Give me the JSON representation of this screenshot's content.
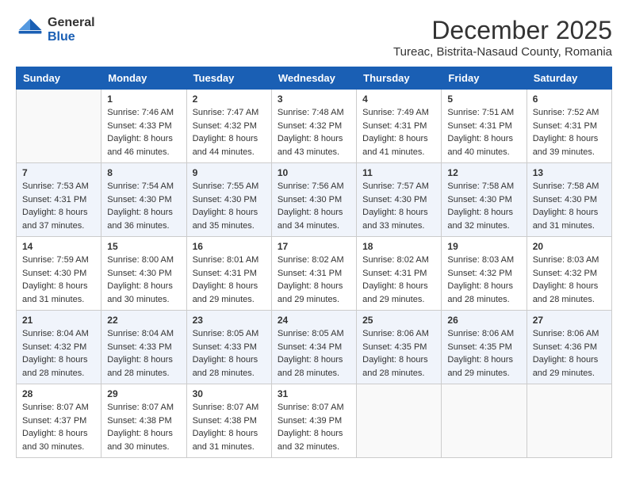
{
  "header": {
    "logo_line1": "General",
    "logo_line2": "Blue",
    "title": "December 2025",
    "subtitle": "Tureac, Bistrita-Nasaud County, Romania"
  },
  "weekdays": [
    "Sunday",
    "Monday",
    "Tuesday",
    "Wednesday",
    "Thursday",
    "Friday",
    "Saturday"
  ],
  "weeks": [
    [
      {
        "day": "",
        "sunrise": "",
        "sunset": "",
        "daylight": ""
      },
      {
        "day": "1",
        "sunrise": "Sunrise: 7:46 AM",
        "sunset": "Sunset: 4:33 PM",
        "daylight": "Daylight: 8 hours and 46 minutes."
      },
      {
        "day": "2",
        "sunrise": "Sunrise: 7:47 AM",
        "sunset": "Sunset: 4:32 PM",
        "daylight": "Daylight: 8 hours and 44 minutes."
      },
      {
        "day": "3",
        "sunrise": "Sunrise: 7:48 AM",
        "sunset": "Sunset: 4:32 PM",
        "daylight": "Daylight: 8 hours and 43 minutes."
      },
      {
        "day": "4",
        "sunrise": "Sunrise: 7:49 AM",
        "sunset": "Sunset: 4:31 PM",
        "daylight": "Daylight: 8 hours and 41 minutes."
      },
      {
        "day": "5",
        "sunrise": "Sunrise: 7:51 AM",
        "sunset": "Sunset: 4:31 PM",
        "daylight": "Daylight: 8 hours and 40 minutes."
      },
      {
        "day": "6",
        "sunrise": "Sunrise: 7:52 AM",
        "sunset": "Sunset: 4:31 PM",
        "daylight": "Daylight: 8 hours and 39 minutes."
      }
    ],
    [
      {
        "day": "7",
        "sunrise": "Sunrise: 7:53 AM",
        "sunset": "Sunset: 4:31 PM",
        "daylight": "Daylight: 8 hours and 37 minutes."
      },
      {
        "day": "8",
        "sunrise": "Sunrise: 7:54 AM",
        "sunset": "Sunset: 4:30 PM",
        "daylight": "Daylight: 8 hours and 36 minutes."
      },
      {
        "day": "9",
        "sunrise": "Sunrise: 7:55 AM",
        "sunset": "Sunset: 4:30 PM",
        "daylight": "Daylight: 8 hours and 35 minutes."
      },
      {
        "day": "10",
        "sunrise": "Sunrise: 7:56 AM",
        "sunset": "Sunset: 4:30 PM",
        "daylight": "Daylight: 8 hours and 34 minutes."
      },
      {
        "day": "11",
        "sunrise": "Sunrise: 7:57 AM",
        "sunset": "Sunset: 4:30 PM",
        "daylight": "Daylight: 8 hours and 33 minutes."
      },
      {
        "day": "12",
        "sunrise": "Sunrise: 7:58 AM",
        "sunset": "Sunset: 4:30 PM",
        "daylight": "Daylight: 8 hours and 32 minutes."
      },
      {
        "day": "13",
        "sunrise": "Sunrise: 7:58 AM",
        "sunset": "Sunset: 4:30 PM",
        "daylight": "Daylight: 8 hours and 31 minutes."
      }
    ],
    [
      {
        "day": "14",
        "sunrise": "Sunrise: 7:59 AM",
        "sunset": "Sunset: 4:30 PM",
        "daylight": "Daylight: 8 hours and 31 minutes."
      },
      {
        "day": "15",
        "sunrise": "Sunrise: 8:00 AM",
        "sunset": "Sunset: 4:30 PM",
        "daylight": "Daylight: 8 hours and 30 minutes."
      },
      {
        "day": "16",
        "sunrise": "Sunrise: 8:01 AM",
        "sunset": "Sunset: 4:31 PM",
        "daylight": "Daylight: 8 hours and 29 minutes."
      },
      {
        "day": "17",
        "sunrise": "Sunrise: 8:02 AM",
        "sunset": "Sunset: 4:31 PM",
        "daylight": "Daylight: 8 hours and 29 minutes."
      },
      {
        "day": "18",
        "sunrise": "Sunrise: 8:02 AM",
        "sunset": "Sunset: 4:31 PM",
        "daylight": "Daylight: 8 hours and 29 minutes."
      },
      {
        "day": "19",
        "sunrise": "Sunrise: 8:03 AM",
        "sunset": "Sunset: 4:32 PM",
        "daylight": "Daylight: 8 hours and 28 minutes."
      },
      {
        "day": "20",
        "sunrise": "Sunrise: 8:03 AM",
        "sunset": "Sunset: 4:32 PM",
        "daylight": "Daylight: 8 hours and 28 minutes."
      }
    ],
    [
      {
        "day": "21",
        "sunrise": "Sunrise: 8:04 AM",
        "sunset": "Sunset: 4:32 PM",
        "daylight": "Daylight: 8 hours and 28 minutes."
      },
      {
        "day": "22",
        "sunrise": "Sunrise: 8:04 AM",
        "sunset": "Sunset: 4:33 PM",
        "daylight": "Daylight: 8 hours and 28 minutes."
      },
      {
        "day": "23",
        "sunrise": "Sunrise: 8:05 AM",
        "sunset": "Sunset: 4:33 PM",
        "daylight": "Daylight: 8 hours and 28 minutes."
      },
      {
        "day": "24",
        "sunrise": "Sunrise: 8:05 AM",
        "sunset": "Sunset: 4:34 PM",
        "daylight": "Daylight: 8 hours and 28 minutes."
      },
      {
        "day": "25",
        "sunrise": "Sunrise: 8:06 AM",
        "sunset": "Sunset: 4:35 PM",
        "daylight": "Daylight: 8 hours and 28 minutes."
      },
      {
        "day": "26",
        "sunrise": "Sunrise: 8:06 AM",
        "sunset": "Sunset: 4:35 PM",
        "daylight": "Daylight: 8 hours and 29 minutes."
      },
      {
        "day": "27",
        "sunrise": "Sunrise: 8:06 AM",
        "sunset": "Sunset: 4:36 PM",
        "daylight": "Daylight: 8 hours and 29 minutes."
      }
    ],
    [
      {
        "day": "28",
        "sunrise": "Sunrise: 8:07 AM",
        "sunset": "Sunset: 4:37 PM",
        "daylight": "Daylight: 8 hours and 30 minutes."
      },
      {
        "day": "29",
        "sunrise": "Sunrise: 8:07 AM",
        "sunset": "Sunset: 4:38 PM",
        "daylight": "Daylight: 8 hours and 30 minutes."
      },
      {
        "day": "30",
        "sunrise": "Sunrise: 8:07 AM",
        "sunset": "Sunset: 4:38 PM",
        "daylight": "Daylight: 8 hours and 31 minutes."
      },
      {
        "day": "31",
        "sunrise": "Sunrise: 8:07 AM",
        "sunset": "Sunset: 4:39 PM",
        "daylight": "Daylight: 8 hours and 32 minutes."
      },
      {
        "day": "",
        "sunrise": "",
        "sunset": "",
        "daylight": ""
      },
      {
        "day": "",
        "sunrise": "",
        "sunset": "",
        "daylight": ""
      },
      {
        "day": "",
        "sunrise": "",
        "sunset": "",
        "daylight": ""
      }
    ]
  ]
}
